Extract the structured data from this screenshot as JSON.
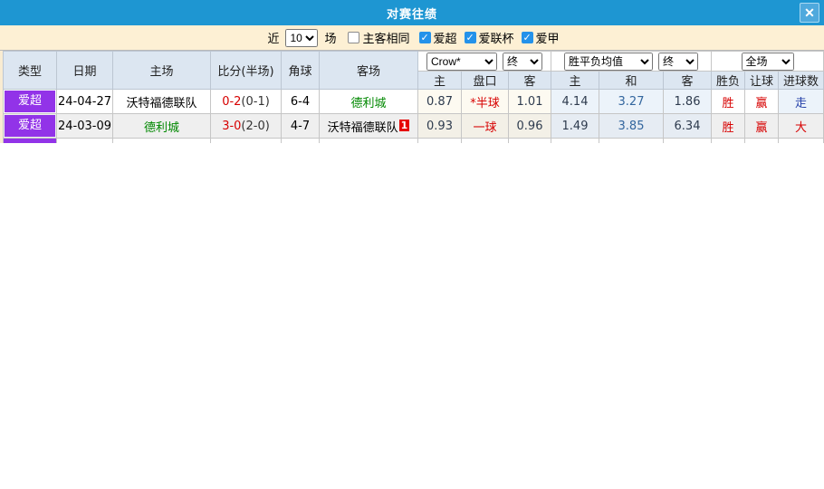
{
  "dialog": {
    "title": "对赛往绩",
    "close_icon": "✕"
  },
  "filter": {
    "recent_label": "近",
    "recent_count": "10",
    "unit_label": "场",
    "same_venue": {
      "label": "主客相同",
      "checked": false
    },
    "leagues": [
      {
        "label": "爱超",
        "checked": true
      },
      {
        "label": "爱联杯",
        "checked": true
      },
      {
        "label": "爱甲",
        "checked": true
      }
    ]
  },
  "table": {
    "main_columns": [
      "类型",
      "日期",
      "主场",
      "比分(半场)",
      "角球",
      "客场"
    ],
    "selectors": {
      "bookmaker": "Crow*",
      "bookmaker_time": "终",
      "europe": "胜平负均值",
      "europe_time": "终",
      "scope": "全场"
    },
    "sub_columns": [
      "主",
      "盘口",
      "客",
      "主",
      "和",
      "客",
      "胜负",
      "让球",
      "进球数"
    ],
    "rows": [
      {
        "league": "爱超",
        "date": "24-04-27",
        "home": "沃特福德联队",
        "score": "0-2",
        "half": "(0-1)",
        "corners": "6-4",
        "away": "德利城",
        "away_badge": "",
        "asian_home": "0.87",
        "handicap": "*半球",
        "asian_away": "1.01",
        "euro_home": "4.14",
        "euro_draw": "3.27",
        "euro_away": "1.86",
        "result": "胜",
        "handicap_result": "赢",
        "goal_result": "走"
      },
      {
        "league": "爱超",
        "date": "24-03-09",
        "home": "德利城",
        "score": "3-0",
        "half": "(2-0)",
        "corners": "4-7",
        "away": "沃特福德联队",
        "away_badge": "1",
        "asian_home": "0.93",
        "handicap": "一球",
        "asian_away": "0.96",
        "euro_home": "1.49",
        "euro_draw": "3.85",
        "euro_away": "6.34",
        "result": "胜",
        "handicap_result": "赢",
        "goal_result": "大"
      }
    ]
  },
  "colors": {
    "titlebar_blue": "#1e96d2",
    "filter_cream": "#fdf0d4",
    "header_bg": "#dce6f1",
    "league_purple": "#9233e8",
    "score_red": "#d70000",
    "team_green": "#008800",
    "goal_navy": "#2440a8"
  }
}
